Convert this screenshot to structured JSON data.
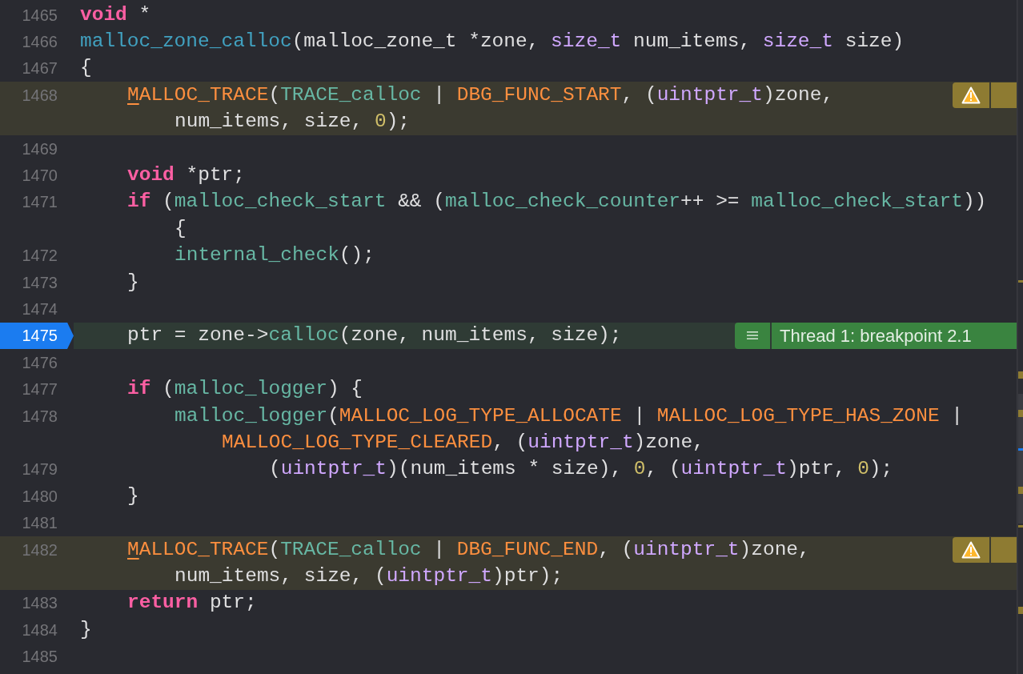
{
  "lines": [
    {
      "number": "1465",
      "current": false,
      "parts": [
        {
          "kind": "i0",
          "spans": [
            {
              "kind": "keyword",
              "text": "void"
            },
            {
              "kind": "plain",
              "text": " *"
            }
          ]
        }
      ]
    },
    {
      "number": "1466",
      "current": false,
      "parts": [
        {
          "kind": "i0",
          "spans": [
            {
              "kind": "decl",
              "text": "malloc_zone_calloc"
            },
            {
              "kind": "plain",
              "text": "(malloc_zone_t *zone, "
            },
            {
              "kind": "type",
              "text": "size_t"
            },
            {
              "kind": "plain",
              "text": " num_items, "
            },
            {
              "kind": "type",
              "text": "size_t"
            },
            {
              "kind": "plain",
              "text": " size)"
            }
          ]
        }
      ]
    },
    {
      "number": "1467",
      "current": false,
      "parts": [
        {
          "kind": "i0",
          "spans": [
            {
              "kind": "plain",
              "text": "{"
            }
          ]
        }
      ]
    },
    {
      "number": "1468",
      "current": false,
      "annotation": {
        "kind": "warning"
      },
      "parts": [
        {
          "kind": "i1",
          "spans": [
            {
              "kind": "flagged",
              "text": "M"
            },
            {
              "kind": "macro",
              "text": "ALLOC_TRACE"
            },
            {
              "kind": "plain",
              "text": "("
            },
            {
              "kind": "func",
              "text": "TRACE_calloc"
            },
            {
              "kind": "plain",
              "text": " | "
            },
            {
              "kind": "macro",
              "text": "DBG_FUNC_START"
            },
            {
              "kind": "plain",
              "text": ", ("
            },
            {
              "kind": "type",
              "text": "uintptr_t"
            },
            {
              "kind": "plain",
              "text": ")zone,"
            }
          ]
        },
        {
          "kind": "i2",
          "spans": [
            {
              "kind": "plain",
              "text": "num_items, size, "
            },
            {
              "kind": "number",
              "text": "0"
            },
            {
              "kind": "plain",
              "text": ");"
            }
          ]
        }
      ]
    },
    {
      "number": "1469",
      "current": false
    },
    {
      "number": "1470",
      "current": false,
      "parts": [
        {
          "kind": "i1",
          "spans": [
            {
              "kind": "keyword",
              "text": "void"
            },
            {
              "kind": "plain",
              "text": " *ptr;"
            }
          ]
        }
      ]
    },
    {
      "number": "1471",
      "current": false,
      "parts": [
        {
          "kind": "i1",
          "spans": [
            {
              "kind": "keyword",
              "text": "if"
            },
            {
              "kind": "plain",
              "text": " ("
            },
            {
              "kind": "func",
              "text": "malloc_check_start"
            },
            {
              "kind": "plain",
              "text": " && ("
            },
            {
              "kind": "func",
              "text": "malloc_check_counter"
            },
            {
              "kind": "plain",
              "text": "++ >= "
            },
            {
              "kind": "func",
              "text": "malloc_check_start"
            },
            {
              "kind": "plain",
              "text": "))"
            }
          ]
        },
        {
          "kind": "i2",
          "spans": [
            {
              "kind": "plain",
              "text": "{"
            }
          ]
        }
      ]
    },
    {
      "number": "1472",
      "current": false,
      "parts": [
        {
          "kind": "i2",
          "spans": [
            {
              "kind": "func",
              "text": "internal_check"
            },
            {
              "kind": "plain",
              "text": "();"
            }
          ]
        }
      ]
    },
    {
      "number": "1473",
      "current": false,
      "parts": [
        {
          "kind": "i1",
          "spans": [
            {
              "kind": "plain",
              "text": "}"
            }
          ]
        }
      ]
    },
    {
      "number": "1474",
      "current": false
    },
    {
      "number": "1475",
      "current": true,
      "annotation": {
        "kind": "breakpoint",
        "label": "Thread 1: breakpoint 2.1"
      },
      "parts": [
        {
          "kind": "i1",
          "spans": [
            {
              "kind": "plain",
              "text": "ptr = zone->"
            },
            {
              "kind": "func",
              "text": "calloc"
            },
            {
              "kind": "plain",
              "text": "(zone, num_items, size);"
            }
          ]
        }
      ]
    },
    {
      "number": "1476",
      "current": false
    },
    {
      "number": "1477",
      "current": false,
      "parts": [
        {
          "kind": "i1",
          "spans": [
            {
              "kind": "keyword",
              "text": "if"
            },
            {
              "kind": "plain",
              "text": " ("
            },
            {
              "kind": "func",
              "text": "malloc_logger"
            },
            {
              "kind": "plain",
              "text": ") {"
            }
          ]
        }
      ]
    },
    {
      "number": "1478",
      "current": false,
      "parts": [
        {
          "kind": "i2",
          "spans": [
            {
              "kind": "func",
              "text": "malloc_logger"
            },
            {
              "kind": "plain",
              "text": "("
            },
            {
              "kind": "macro",
              "text": "MALLOC_LOG_TYPE_ALLOCATE"
            },
            {
              "kind": "plain",
              "text": " | "
            },
            {
              "kind": "macro",
              "text": "MALLOC_LOG_TYPE_HAS_ZONE"
            },
            {
              "kind": "plain",
              "text": " |"
            }
          ]
        },
        {
          "kind": "i3",
          "spans": [
            {
              "kind": "macro",
              "text": "MALLOC_LOG_TYPE_CLEARED"
            },
            {
              "kind": "plain",
              "text": ", ("
            },
            {
              "kind": "type",
              "text": "uintptr_t"
            },
            {
              "kind": "plain",
              "text": ")zone,"
            }
          ]
        }
      ]
    },
    {
      "number": "1479",
      "current": false,
      "parts": [
        {
          "kind": "i4",
          "spans": [
            {
              "kind": "plain",
              "text": "("
            },
            {
              "kind": "type",
              "text": "uintptr_t"
            },
            {
              "kind": "plain",
              "text": ")(num_items * size), "
            },
            {
              "kind": "number",
              "text": "0"
            },
            {
              "kind": "plain",
              "text": ", ("
            },
            {
              "kind": "type",
              "text": "uintptr_t"
            },
            {
              "kind": "plain",
              "text": ")ptr, "
            },
            {
              "kind": "number",
              "text": "0"
            },
            {
              "kind": "plain",
              "text": ");"
            }
          ]
        }
      ]
    },
    {
      "number": "1480",
      "current": false,
      "parts": [
        {
          "kind": "i1",
          "spans": [
            {
              "kind": "plain",
              "text": "}"
            }
          ]
        }
      ]
    },
    {
      "number": "1481",
      "current": false
    },
    {
      "number": "1482",
      "current": false,
      "annotation": {
        "kind": "warning"
      },
      "parts": [
        {
          "kind": "i1",
          "spans": [
            {
              "kind": "flagged",
              "text": "M"
            },
            {
              "kind": "macro",
              "text": "ALLOC_TRACE"
            },
            {
              "kind": "plain",
              "text": "("
            },
            {
              "kind": "func",
              "text": "TRACE_calloc"
            },
            {
              "kind": "plain",
              "text": " | "
            },
            {
              "kind": "macro",
              "text": "DBG_FUNC_END"
            },
            {
              "kind": "plain",
              "text": ", ("
            },
            {
              "kind": "type",
              "text": "uintptr_t"
            },
            {
              "kind": "plain",
              "text": ")zone,"
            }
          ]
        },
        {
          "kind": "i2",
          "spans": [
            {
              "kind": "plain",
              "text": "num_items, size, ("
            },
            {
              "kind": "type",
              "text": "uintptr_t"
            },
            {
              "kind": "plain",
              "text": ")ptr);"
            }
          ]
        }
      ]
    },
    {
      "number": "1483",
      "current": false,
      "parts": [
        {
          "kind": "i1",
          "spans": [
            {
              "kind": "keyword",
              "text": "return"
            },
            {
              "kind": "plain",
              "text": " ptr;"
            }
          ]
        }
      ]
    },
    {
      "number": "1484",
      "current": false,
      "parts": [
        {
          "kind": "i0",
          "spans": [
            {
              "kind": "plain",
              "text": "}"
            }
          ]
        }
      ]
    },
    {
      "number": "1485",
      "current": false
    }
  ]
}
